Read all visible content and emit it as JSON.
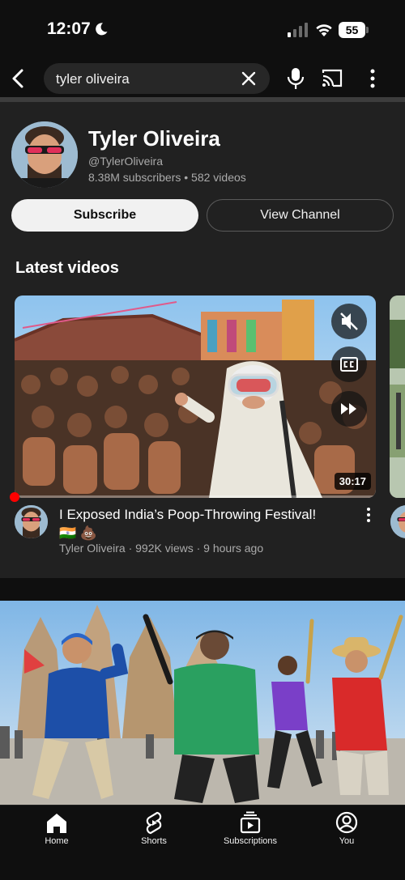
{
  "status_bar": {
    "time": "12:07",
    "battery": "55"
  },
  "search": {
    "query": "tyler oliveira"
  },
  "channel": {
    "name": "Tyler Oliveira",
    "handle": "@TylerOliveira",
    "stats": "8.38M subscribers • 582 videos",
    "subscribe_label": "Subscribe",
    "view_channel_label": "View Channel"
  },
  "latest": {
    "heading": "Latest videos",
    "video": {
      "title": "I Exposed India’s Poop-Throwing Festival!",
      "emoji": "🇮🇳 💩",
      "meta": "Tyler Oliveira · 992K views · 9 hours ago",
      "duration": "30:17",
      "progress": 0.01
    }
  },
  "bottom_nav": {
    "items": [
      {
        "label": "Home",
        "icon": "home-icon",
        "active": true
      },
      {
        "label": "Shorts",
        "icon": "shorts-icon"
      },
      {
        "label": "Subscriptions",
        "icon": "subscriptions-icon"
      },
      {
        "label": "You",
        "icon": "you-icon"
      }
    ]
  },
  "colors": {
    "background": "#0f0f0f",
    "card": "#212121",
    "accent_red": "#ff0000",
    "text_secondary": "#aaaaaa"
  }
}
